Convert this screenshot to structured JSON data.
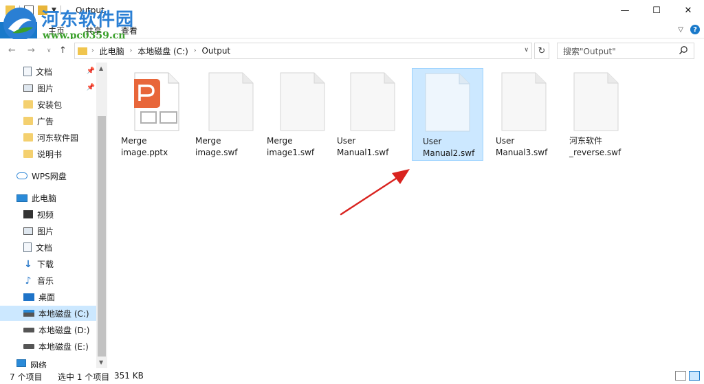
{
  "window": {
    "title": "Output"
  },
  "logo": {
    "text": "河东软件园",
    "url": "www.pc0359.cn"
  },
  "ribbon": {
    "tabs": [
      "文件",
      "主页",
      "共享",
      "查看"
    ]
  },
  "address": {
    "crumbs": [
      "此电脑",
      "本地磁盘 (C:)",
      "Output"
    ]
  },
  "search": {
    "placeholder": "搜索\"Output\""
  },
  "sidebar": {
    "quick_access": [
      {
        "label": "文档",
        "icon": "document-icon",
        "pinned": true
      },
      {
        "label": "图片",
        "icon": "pictures-icon",
        "pinned": true
      },
      {
        "label": "安装包",
        "icon": "folder-icon",
        "pinned": false
      },
      {
        "label": "广告",
        "icon": "folder-icon",
        "pinned": false
      },
      {
        "label": "河东软件园",
        "icon": "folder-icon",
        "pinned": false
      },
      {
        "label": "说明书",
        "icon": "folder-icon",
        "pinned": false
      }
    ],
    "cloud": {
      "label": "WPS网盘",
      "icon": "cloud-icon"
    },
    "this_pc": {
      "label": "此电脑",
      "icon": "computer-icon"
    },
    "pc_items": [
      {
        "label": "视频",
        "icon": "video-icon"
      },
      {
        "label": "图片",
        "icon": "pictures-icon"
      },
      {
        "label": "文档",
        "icon": "document-icon"
      },
      {
        "label": "下载",
        "icon": "download-icon"
      },
      {
        "label": "音乐",
        "icon": "music-icon"
      },
      {
        "label": "桌面",
        "icon": "desktop-icon"
      },
      {
        "label": "本地磁盘 (C:)",
        "icon": "drive-c-icon",
        "selected": true
      },
      {
        "label": "本地磁盘 (D:)",
        "icon": "drive-icon"
      },
      {
        "label": "本地磁盘 (E:)",
        "icon": "drive-icon"
      }
    ],
    "network": {
      "label": "网络",
      "icon": "network-icon"
    }
  },
  "files": [
    {
      "name": "Merge image.pptx",
      "line1": "Merge",
      "line2": "image.pptx",
      "type": "pptx",
      "selected": false
    },
    {
      "name": "Merge image.swf",
      "line1": "Merge",
      "line2": "image.swf",
      "type": "blank",
      "selected": false
    },
    {
      "name": "Merge image1.swf",
      "line1": "Merge",
      "line2": "image1.swf",
      "type": "blank",
      "selected": false
    },
    {
      "name": "User Manual1.swf",
      "line1": "User",
      "line2": "Manual1.swf",
      "type": "blank",
      "selected": false
    },
    {
      "name": "User Manual2.swf",
      "line1": "User",
      "line2": "Manual2.swf",
      "type": "blank",
      "selected": true
    },
    {
      "name": "User Manual3.swf",
      "line1": "User",
      "line2": "Manual3.swf",
      "type": "blank",
      "selected": false
    },
    {
      "name": "河东软件_reverse.swf",
      "line1": "河东软件",
      "line2": "_reverse.swf",
      "type": "blank",
      "selected": false
    }
  ],
  "status": {
    "count": "7 个项目",
    "selection": "选中 1 个项目",
    "size": "351 KB"
  },
  "colors": {
    "accent": "#1979ca",
    "selection_bg": "#cce8ff",
    "selection_border": "#99d1ff",
    "pptx_orange": "#e8663a",
    "arrow_red": "#d9231f"
  }
}
